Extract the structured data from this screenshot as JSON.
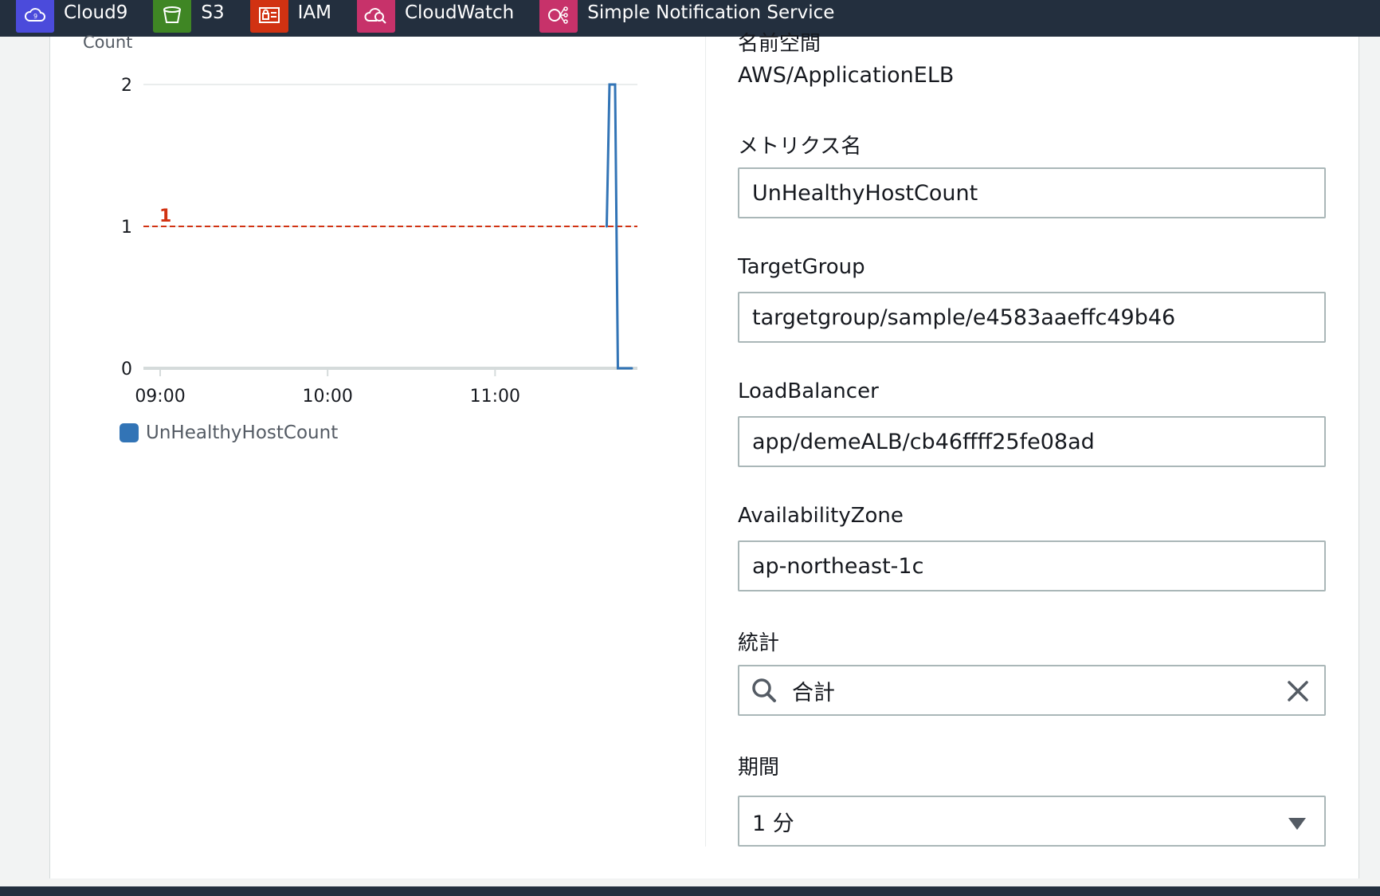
{
  "favorites_bar": {
    "items": [
      {
        "label": "Cloud9",
        "icon": "cloud9-icon",
        "color": "#4b4bdb"
      },
      {
        "label": "S3",
        "icon": "s3-bucket-icon",
        "color": "#3f8624"
      },
      {
        "label": "IAM",
        "icon": "iam-icon",
        "color": "#d13212"
      },
      {
        "label": "CloudWatch",
        "icon": "cloudwatch-icon",
        "color": "#c7326a"
      },
      {
        "label": "Simple Notification Service",
        "icon": "sns-icon",
        "color": "#c7326a"
      }
    ]
  },
  "chart": {
    "y_axis_label": "Count",
    "legend": "UnHealthyHostCount",
    "threshold_label": "1"
  },
  "chart_data": {
    "type": "line",
    "title": "",
    "ylabel": "Count",
    "xlabel": "",
    "ylim": [
      0,
      2
    ],
    "yticks": [
      "0",
      "1",
      "2"
    ],
    "xticks": [
      "09:00",
      "10:00",
      "11:00"
    ],
    "x_start": "08:54",
    "x_end": "11:51",
    "series": [
      {
        "name": "UnHealthyHostCount",
        "color": "#3274b6",
        "points": [
          {
            "x": "11:40",
            "y": 1
          },
          {
            "x": "11:41",
            "y": 2
          },
          {
            "x": "11:43",
            "y": 2
          },
          {
            "x": "11:44",
            "y": 0
          },
          {
            "x": "11:49",
            "y": 0
          }
        ]
      }
    ],
    "threshold": {
      "value": 1,
      "color": "#d13212",
      "style": "dashed"
    }
  },
  "form": {
    "namespace": {
      "label": "名前空間",
      "value": "AWS/ApplicationELB"
    },
    "metric_name": {
      "label": "メトリクス名",
      "value": "UnHealthyHostCount"
    },
    "target_group": {
      "label": "TargetGroup",
      "value": "targetgroup/sample/e4583aaeffc49b46"
    },
    "load_balancer": {
      "label": "LoadBalancer",
      "value": "app/demeALB/cb46ffff25fe08ad"
    },
    "availability_zone": {
      "label": "AvailabilityZone",
      "value": "ap-northeast-1c"
    },
    "statistic": {
      "label": "統計",
      "value": "合計"
    },
    "period": {
      "label": "期間",
      "value": "1 分"
    }
  }
}
